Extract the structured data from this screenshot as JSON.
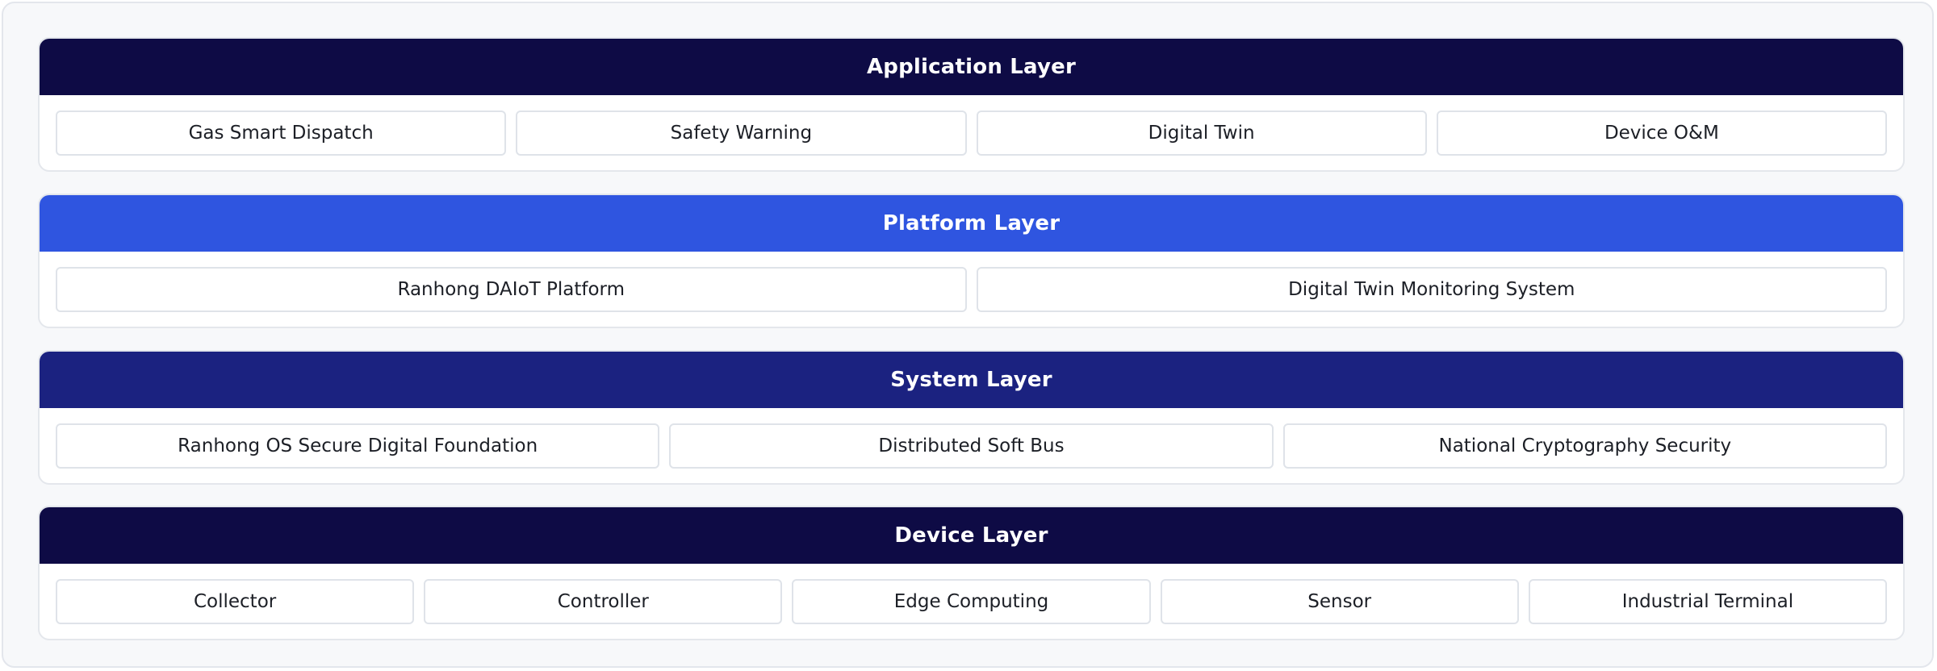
{
  "layers": [
    {
      "title": "Application Layer",
      "color": "#0e0b45",
      "items": [
        "Gas Smart Dispatch",
        "Safety Warning",
        "Digital Twin",
        "Device O&M"
      ]
    },
    {
      "title": "Platform Layer",
      "color": "#2f55e0",
      "items": [
        "Ranhong DAIoT Platform",
        "Digital Twin Monitoring System"
      ]
    },
    {
      "title": "System Layer",
      "color": "#1b2280",
      "items": [
        "Ranhong OS Secure Digital Foundation",
        "Distributed Soft Bus",
        "National Cryptography Security"
      ]
    },
    {
      "title": "Device Layer",
      "color": "#0e0b45",
      "items": [
        "Collector",
        "Controller",
        "Edge Computing",
        "Sensor",
        "Industrial Terminal"
      ]
    }
  ]
}
